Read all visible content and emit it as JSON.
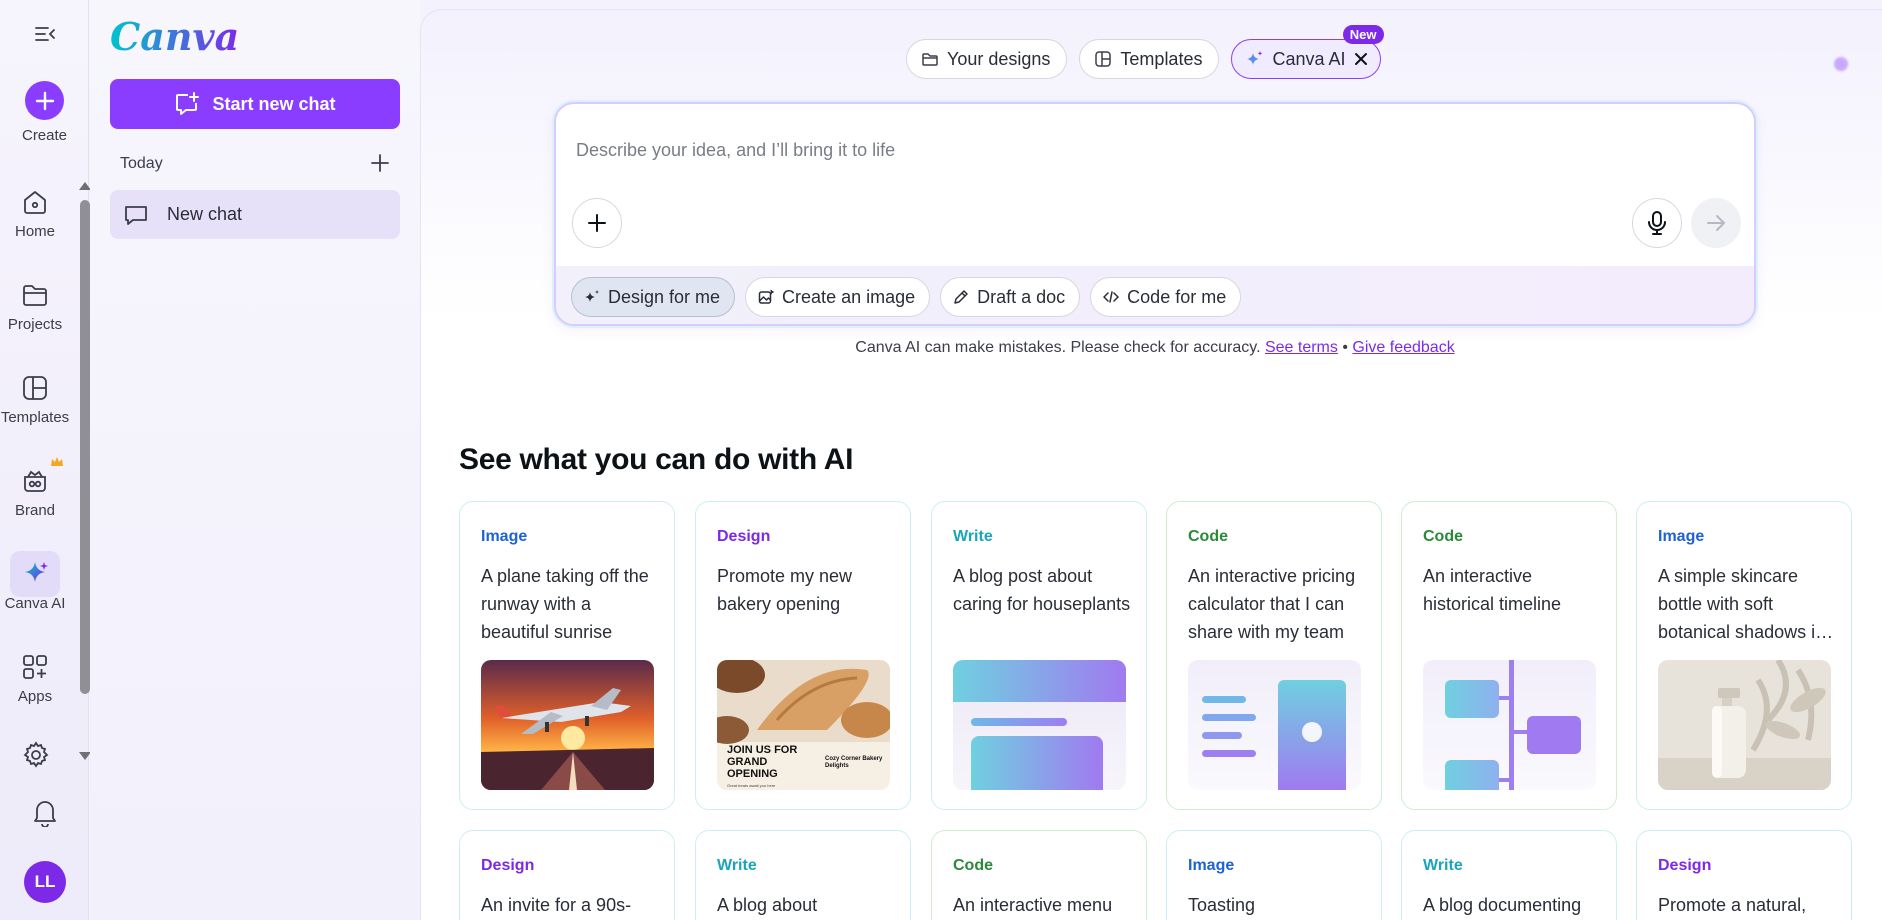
{
  "colors": {
    "brand_purple": "#8b3dff",
    "image_tag": "#1e62d6",
    "design_tag": "#7d2ae8",
    "write_tag": "#19a6b8",
    "code_tag": "#2a8a38"
  },
  "rail": {
    "create_label": "Create",
    "items": [
      {
        "label": "Home",
        "icon": "home-icon"
      },
      {
        "label": "Projects",
        "icon": "folder-icon"
      },
      {
        "label": "Templates",
        "icon": "templates-icon"
      },
      {
        "label": "Brand",
        "icon": "brand-icon"
      },
      {
        "label": "Canva AI",
        "icon": "sparkle-icon"
      },
      {
        "label": "Apps",
        "icon": "apps-icon"
      }
    ],
    "avatar_initials": "LL"
  },
  "panel": {
    "logo": "Canva",
    "start_chat_label": "Start new chat",
    "today_label": "Today",
    "chats": [
      {
        "label": "New chat"
      }
    ]
  },
  "tabs": [
    {
      "label": "Your designs",
      "icon": "folder-icon"
    },
    {
      "label": "Templates",
      "icon": "templates-icon"
    },
    {
      "label": "Canva AI",
      "icon": "sparkle-icon",
      "badge": "New"
    }
  ],
  "prompt": {
    "placeholder": "Describe your idea, and I’ll bring it to life",
    "chips": [
      {
        "label": "Design for me",
        "icon": "sparkle-icon"
      },
      {
        "label": "Create an image",
        "icon": "image-icon"
      },
      {
        "label": "Draft a doc",
        "icon": "pen-icon"
      },
      {
        "label": "Code for me",
        "icon": "code-icon"
      }
    ]
  },
  "disclaimer": {
    "text": "Canva AI can make mistakes. Please check for accuracy.",
    "terms_link": "See terms",
    "separator": "•",
    "feedback_link": "Give feedback"
  },
  "section_title": "See what you can do with AI",
  "cards_row1": [
    {
      "tag": "Image",
      "desc": "A plane taking off the runway with a beautiful sunrise"
    },
    {
      "tag": "Design",
      "desc": "Promote my new bakery opening",
      "thumb_text": "JOIN US FOR GRAND OPENING",
      "thumb_small": "Cozy Corner Bakery Delights",
      "thumb_tiny": "Great treats await you here"
    },
    {
      "tag": "Write",
      "desc": "A blog post about caring for houseplants"
    },
    {
      "tag": "Code",
      "desc": "An interactive pricing calculator that I can share with my team"
    },
    {
      "tag": "Code",
      "desc": "An interactive historical timeline"
    },
    {
      "tag": "Image",
      "desc": "A simple skincare bottle with soft botanical shadows in the background"
    }
  ],
  "cards_row2": [
    {
      "tag": "Design",
      "desc": "An invite for a 90s-"
    },
    {
      "tag": "Write",
      "desc": "A blog about"
    },
    {
      "tag": "Code",
      "desc": "An interactive menu"
    },
    {
      "tag": "Image",
      "desc": "Toasting"
    },
    {
      "tag": "Write",
      "desc": "A blog documenting"
    },
    {
      "tag": "Design",
      "desc": "Promote a natural,"
    }
  ]
}
